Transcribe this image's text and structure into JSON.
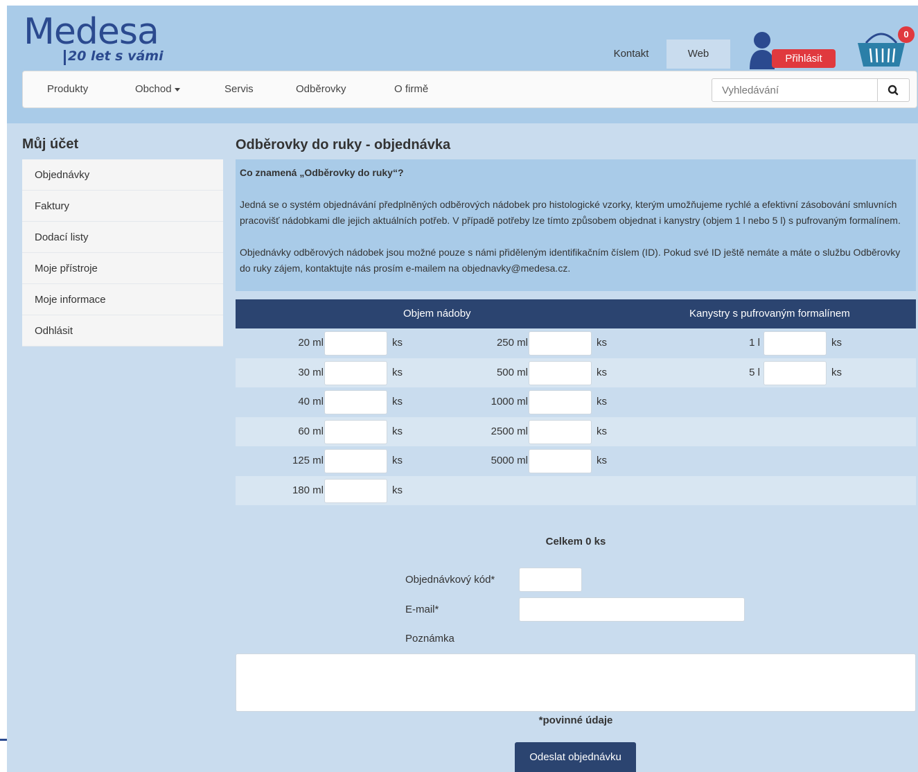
{
  "header": {
    "logo_word": "Medesa",
    "logo_tagline": "20 let s vámi",
    "top_links": [
      {
        "label": "Kontakt"
      },
      {
        "label": "Web"
      }
    ],
    "login_label": "Přihlásit",
    "cart_count": "0",
    "colors": {
      "brand": "#2b4a8f",
      "login": "#e0393e",
      "header_bg": "#a9cbe8"
    }
  },
  "nav": {
    "items": [
      {
        "label": "Produkty"
      },
      {
        "label": "Obchod"
      },
      {
        "label": "Servis"
      },
      {
        "label": "Odběrovky"
      },
      {
        "label": "O firmě"
      }
    ],
    "search_placeholder": "Vyhledávání",
    "search_icon": "search-icon"
  },
  "sidebar": {
    "title": "Můj účet",
    "items": [
      {
        "label": "Objednávky"
      },
      {
        "label": "Faktury"
      },
      {
        "label": "Dodací listy"
      },
      {
        "label": "Moje přístroje"
      },
      {
        "label": "Moje informace"
      },
      {
        "label": "Odhlásit"
      }
    ]
  },
  "main": {
    "title": "Odběrovky do ruky - objednávka",
    "info": {
      "question": "Co znamená „Odběrovky do ruky“?",
      "paragraph1": "Jedná se o systém objednávání předplněných odběrových nádobek pro histologické vzorky, kterým umožňujeme rychlé a efektivní zásobování smluvních pracovišť nádobkami dle jejich aktuálních potřeb. V případě potřeby lze tímto způsobem objednat i kanystry (objem 1 l nebo 5 l) s pufrovaným formalínem.",
      "paragraph2": "Objednávky odběrových nádobek jsou možné pouze s námi přiděleným identifikačním číslem (ID). Pokud své ID ještě nemáte a máte o službu Odběrovky do ruky zájem, kontaktujte nás prosím e-mailem na objednavky@medesa.cz."
    },
    "table": {
      "header_volume": "Objem nádoby",
      "header_canisters": "Kanystry s pufrovaným formalínem",
      "unit": "ks",
      "rows": [
        {
          "a": "20 ml",
          "b": "250 ml",
          "c": "1 l"
        },
        {
          "a": "30 ml",
          "b": "500 ml",
          "c": "5 l"
        },
        {
          "a": "40 ml",
          "b": "1000 ml",
          "c": ""
        },
        {
          "a": "60 ml",
          "b": "2500 ml",
          "c": ""
        },
        {
          "a": "125 ml",
          "b": "5000 ml",
          "c": ""
        },
        {
          "a": "180 ml",
          "b": "",
          "c": ""
        }
      ],
      "header_color": "#2b4470"
    },
    "total": "Celkem 0 ks",
    "form": {
      "order_code_label": "Objednávkový kód*",
      "email_label": "E-mail*",
      "note_label": "Poznámka"
    },
    "required_note": "*povinné údaje",
    "submit_label": "Odeslat objednávku"
  }
}
